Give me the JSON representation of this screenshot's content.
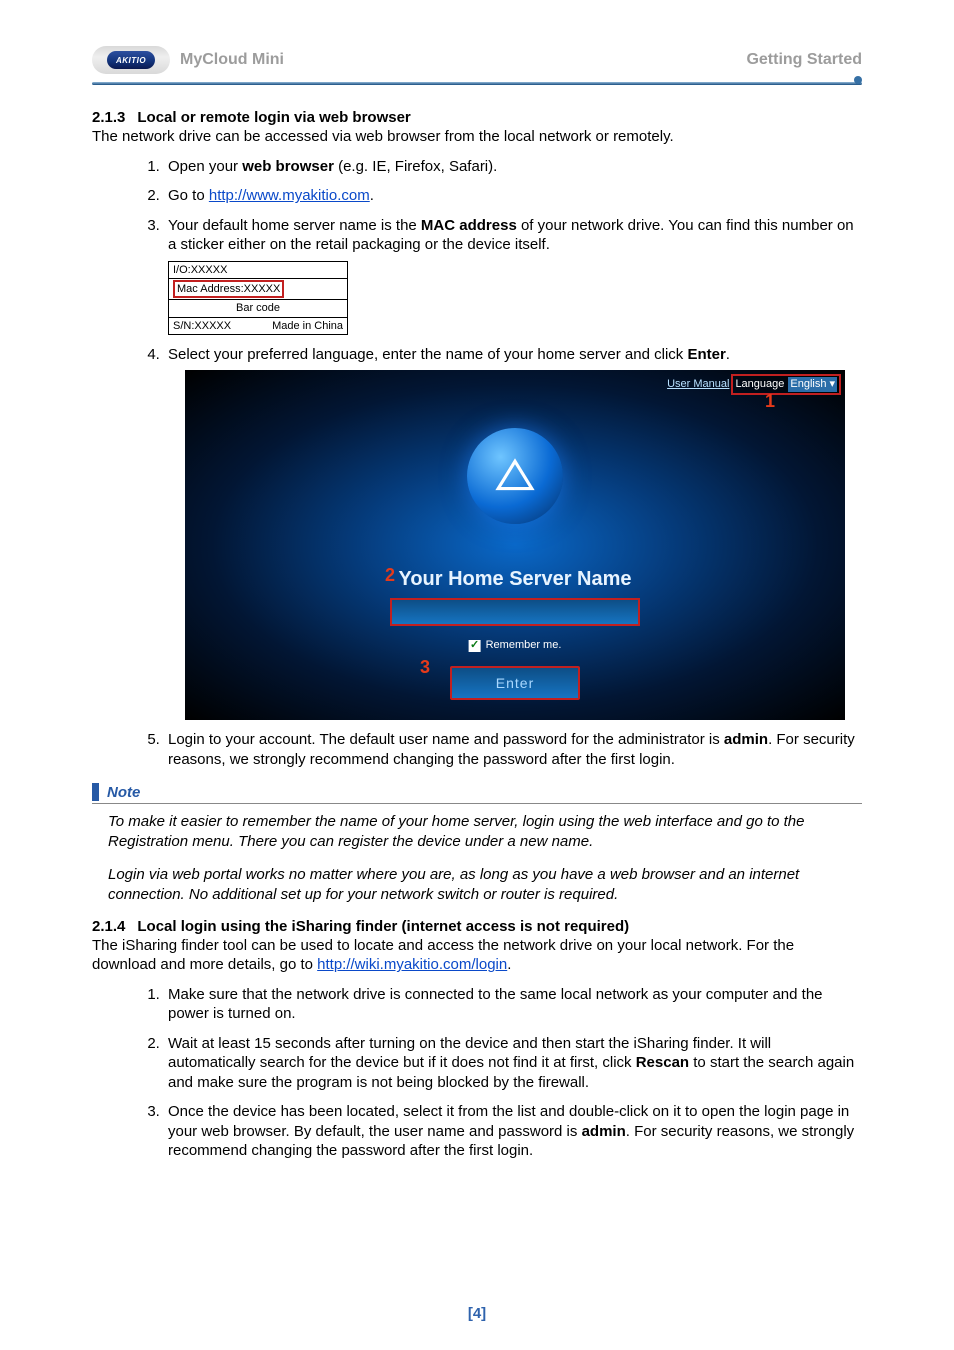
{
  "header": {
    "logo_text": "AKITIO",
    "product": "MyCloud Mini",
    "section": "Getting Started"
  },
  "sec213": {
    "num": "2.1.3",
    "title": "Local or remote login via web browser",
    "intro": "The network drive can be accessed via web browser from the local network or remotely.",
    "steps": {
      "s1_a": "Open your ",
      "s1_b": "web browser",
      "s1_c": " (e.g. IE, Firefox, Safari).",
      "s2_a": "Go to ",
      "s2_link": "http://www.myakitio.com",
      "s2_b": ".",
      "s3_a": "Your default home server name is the ",
      "s3_b": "MAC address",
      "s3_c": " of your network drive. You can find this number on a sticker either on the retail packaging or the device itself.",
      "s4_a": "Select your preferred language, enter the name of your home server and click ",
      "s4_b": "Enter",
      "s4_c": ".",
      "s5_a": "Login to your account. The default user name and password for the administrator is ",
      "s5_b": "admin",
      "s5_c": ". For security reasons, we strongly recommend changing the password after the first login."
    }
  },
  "sticker": {
    "io": "I/O:XXXXX",
    "mac": "Mac Address:XXXXX",
    "barcode": "Bar code",
    "sn": "S/N:XXXXX",
    "origin": "Made in China"
  },
  "portal": {
    "user_manual": "User Manual",
    "language_label": "Language",
    "language_value": "English",
    "marker1": "1",
    "marker2": "2",
    "marker3": "3",
    "server_label": "Your Home Server Name",
    "remember": "Remember me.",
    "enter": "Enter"
  },
  "note": {
    "label": "Note",
    "p1": "To make it easier to remember the name of your home server, login using the web interface and go to the Registration menu. There you can register the device under a new name.",
    "p2": "Login via web portal works no matter where you are, as long as you have a web browser and an internet connection. No additional set up for your network switch or router is required."
  },
  "sec214": {
    "num": "2.1.4",
    "title": "Local login using the iSharing finder (internet access is not required)",
    "intro_a": "The iSharing finder tool can be used to locate and access the network drive on your local network. For the download and more details, go to ",
    "intro_link": "http://wiki.myakitio.com/login",
    "intro_b": ".",
    "steps": {
      "s1": "Make sure that the network drive is connected to the same local network as your computer and the power is turned on.",
      "s2_a": "Wait at least 15 seconds after turning on the device and then start the iSharing finder. It will automatically search for the device but if it does not find it at first, click ",
      "s2_b": "Rescan",
      "s2_c": " to start the search again and make sure the program is not being blocked by the firewall.",
      "s3_a": "Once the device has been located, select it from the list and double-click on it to open the login page in your web browser. By default, the user name and password is ",
      "s3_b": "admin",
      "s3_c": ". For security reasons, we strongly recommend changing the password after the first login."
    }
  },
  "page_number": "[4]"
}
